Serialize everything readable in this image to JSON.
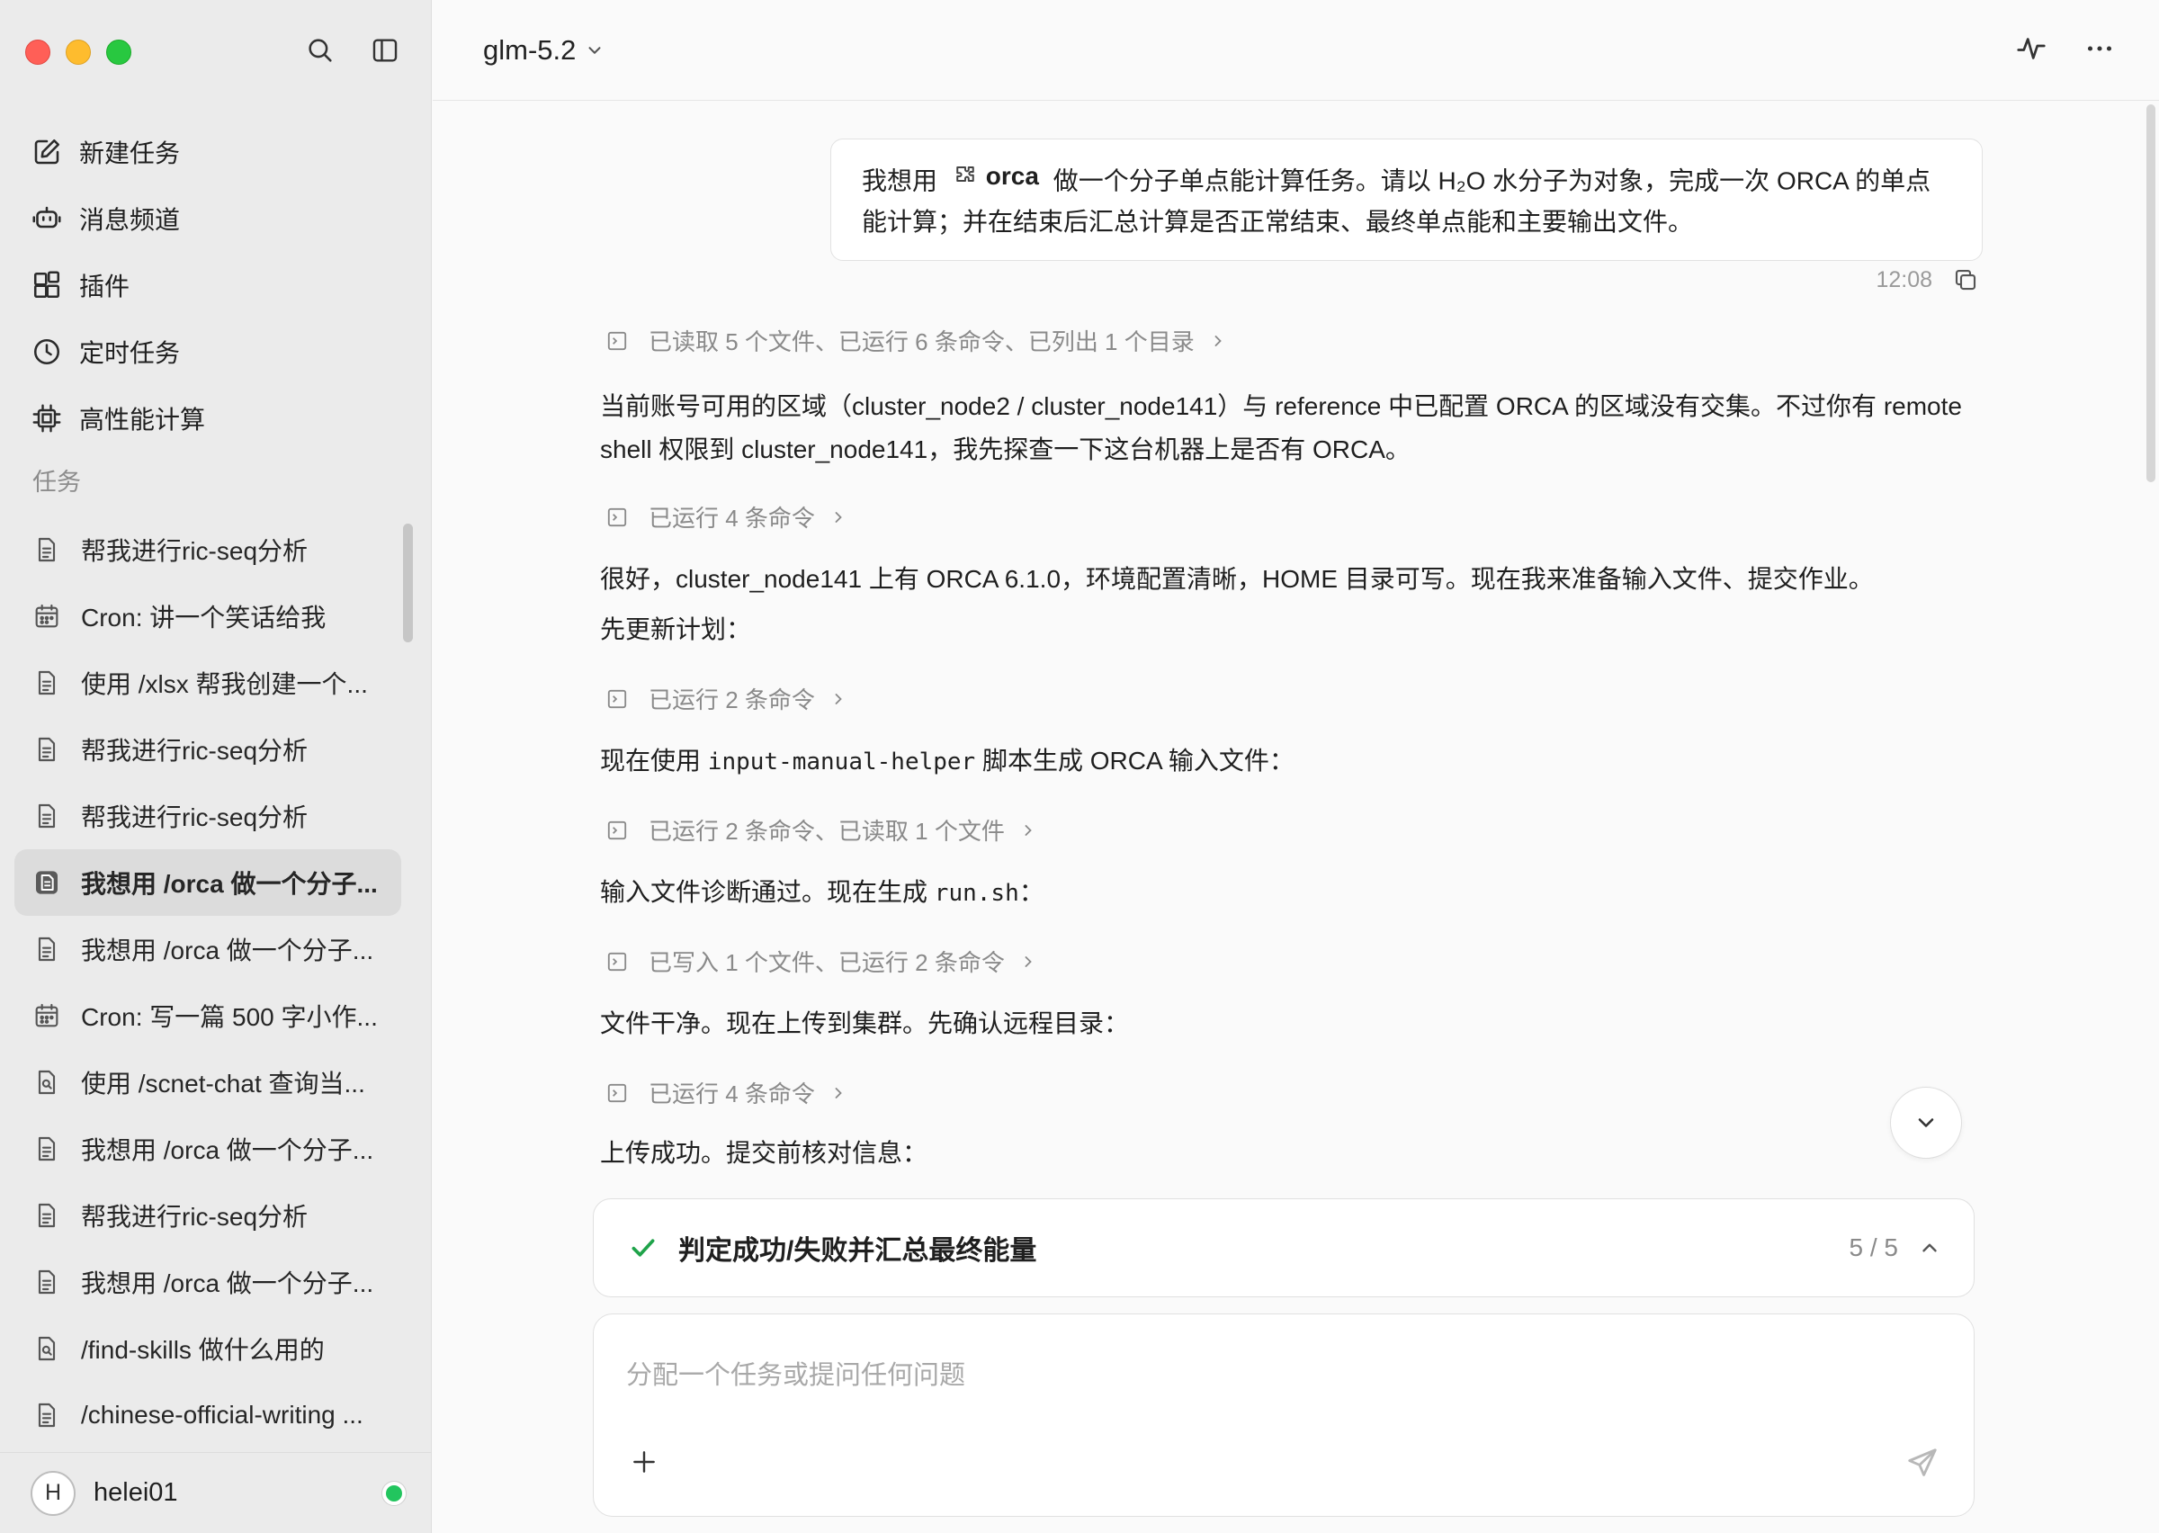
{
  "sidebar": {
    "nav": [
      {
        "label": "新建任务",
        "icon": "new-task-icon"
      },
      {
        "label": "消息频道",
        "icon": "bot-channel-icon"
      },
      {
        "label": "插件",
        "icon": "plugin-grid-icon"
      },
      {
        "label": "定时任务",
        "icon": "clock-icon"
      },
      {
        "label": "高性能计算",
        "icon": "chip-icon"
      }
    ],
    "section_label": "任务",
    "tasks": [
      {
        "label": "帮我进行ric-seq分析",
        "icon": "document-icon"
      },
      {
        "label": "Cron: 讲一个笑话给我",
        "icon": "calendar-icon"
      },
      {
        "label": "使用 /xlsx 帮我创建一个...",
        "icon": "document-icon"
      },
      {
        "label": "帮我进行ric-seq分析",
        "icon": "document-icon"
      },
      {
        "label": "帮我进行ric-seq分析",
        "icon": "document-icon"
      },
      {
        "label": "我想用 /orca 做一个分子...",
        "icon": "document-icon",
        "active": true
      },
      {
        "label": "我想用 /orca 做一个分子...",
        "icon": "document-icon"
      },
      {
        "label": "Cron: 写一篇 500 字小作...",
        "icon": "calendar-icon"
      },
      {
        "label": "使用 /scnet-chat 查询当...",
        "icon": "search-document-icon"
      },
      {
        "label": "我想用 /orca 做一个分子...",
        "icon": "document-icon"
      },
      {
        "label": "帮我进行ric-seq分析",
        "icon": "document-icon"
      },
      {
        "label": "我想用 /orca 做一个分子...",
        "icon": "document-icon"
      },
      {
        "label": "/find-skills 做什么用的",
        "icon": "search-document-icon"
      },
      {
        "label": "/chinese-official-writing ...",
        "icon": "document-icon"
      }
    ],
    "user": {
      "initial": "H",
      "name": "helei01",
      "status_color": "#22c55e"
    }
  },
  "header": {
    "model": "glm-5.2"
  },
  "conversation": {
    "user_message": {
      "prefix": "我想用",
      "plugin": "orca",
      "line1_rest": "做一个分子单点能计算任务。请以 H₂O 水分子为对象，完成一次 ORCA 的单点",
      "line2": "能计算；并在结束后汇总计算是否正常结束、最终单点能和主要输出文件。",
      "time": "12:08"
    },
    "tool1": "已读取 5 个文件、已运行 6 条命令、已列出 1 个目录",
    "text1_l1": "当前账号可用的区域（cluster_node2 / cluster_node141）与 reference 中已配置 ORCA 的区域没有交集。不过你有 remote",
    "text1_l2": "shell 权限到 cluster_node141，我先探查一下这台机器上是否有 ORCA。",
    "tool2": "已运行 4 条命令",
    "text2_l1": "很好，cluster_node141 上有 ORCA 6.1.0，环境配置清晰，HOME 目录可写。现在我来准备输入文件、提交作业。",
    "text2_l2": "先更新计划：",
    "tool3": "已运行 2 条命令",
    "text3_pre": "现在使用",
    "text3_code": "input-manual-helper",
    "text3_post": "脚本生成 ORCA 输入文件：",
    "tool4": "已运行 2 条命令、已读取 1 个文件",
    "text4_pre": "输入文件诊断通过。现在生成",
    "text4_code": "run.sh",
    "text4_post": "：",
    "tool5": "已写入 1 个文件、已运行 2 条命令",
    "text5": "文件干净。现在上传到集群。先确认远程目录：",
    "tool6": "已运行 4 条命令",
    "text6": "上传成功。提交前核对信息："
  },
  "plan": {
    "title": "判定成功/失败并汇总最终能量",
    "count": "5 / 5",
    "accent": "#1fa34a"
  },
  "composer": {
    "placeholder": "分配一个任务或提问任何问题"
  }
}
